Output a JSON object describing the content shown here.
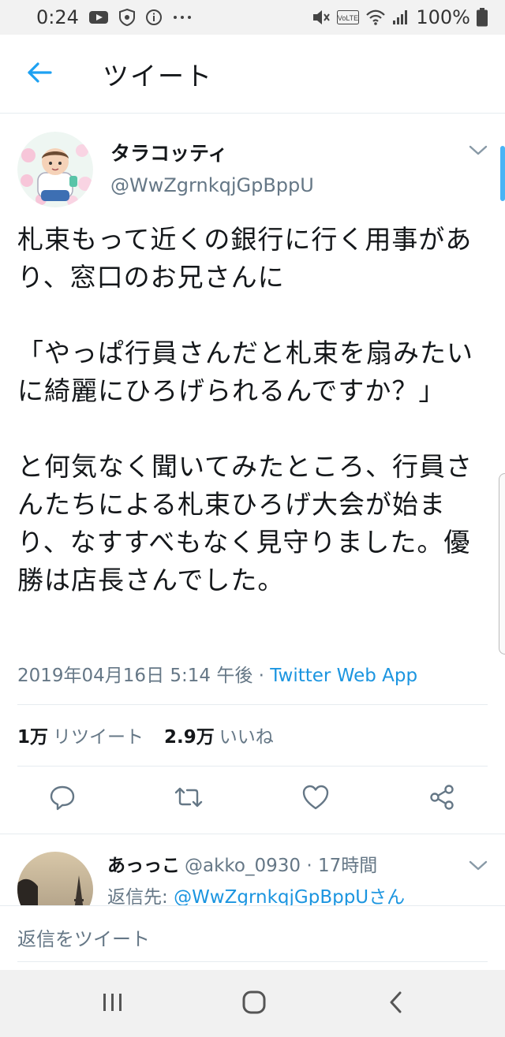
{
  "status_bar": {
    "time": "0:24",
    "battery": "100%",
    "network_badge": "VoLTE",
    "icons": [
      "youtube-icon",
      "vpn-shield-icon",
      "info-icon",
      "more-dots-icon",
      "mute-icon",
      "volte-icon",
      "wifi-icon",
      "signal-icon",
      "battery-icon"
    ]
  },
  "header": {
    "title": "ツイート",
    "back_icon": "back-arrow-icon"
  },
  "tweet": {
    "display_name": "タラコッティ",
    "handle": "@WwZgrnkqjGpBppU",
    "text": "札束もって近くの銀行に行く用事があり、窓口のお兄さんに\n\n「やっぱ行員さんだと札束を扇みたいに綺麗にひろげられるんですか？」\n\nと何気なく聞いてみたところ、行員さんたちによる札束ひろげ大会が始まり、なすすべもなく見守りました。優勝は店長さんでした。",
    "timestamp": "2019年04月16日 5:14 午後",
    "separator": " · ",
    "source": "Twitter Web App",
    "retweet_count": "1万",
    "retweet_label": "リツイート",
    "like_count": "2.9万",
    "like_label": "いいね"
  },
  "reply": {
    "display_name": "あっっこ",
    "handle_time": "@akko_0930 · 17時間",
    "reply_to_label": "返信先: ",
    "reply_to_handle": "@WwZgrnkqjGpBppUさん"
  },
  "compose": {
    "placeholder": "返信をツイート"
  },
  "colors": {
    "accent": "#1da1f2",
    "link": "#1b95e0",
    "secondary_text": "#657786",
    "primary_text": "#14171a",
    "divider": "#e6ecf0"
  }
}
